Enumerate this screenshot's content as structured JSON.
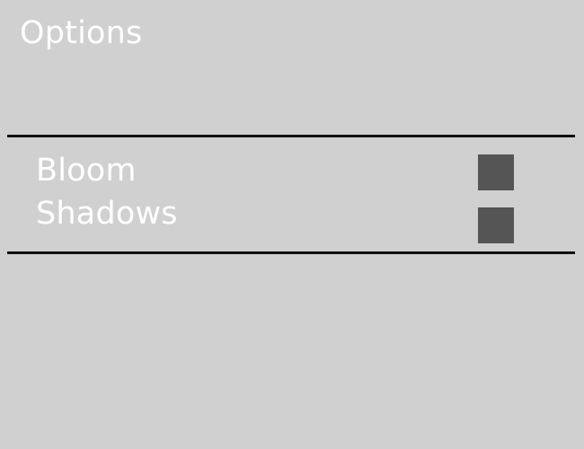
{
  "menu": {
    "title": "Options"
  },
  "options": [
    {
      "label": "Bloom",
      "checked": false
    },
    {
      "label": "Shadows",
      "checked": false
    }
  ],
  "colors": {
    "background": "#d0d0d0",
    "text": "#ffffff",
    "divider": "#101010",
    "checkbox": "#555555"
  }
}
